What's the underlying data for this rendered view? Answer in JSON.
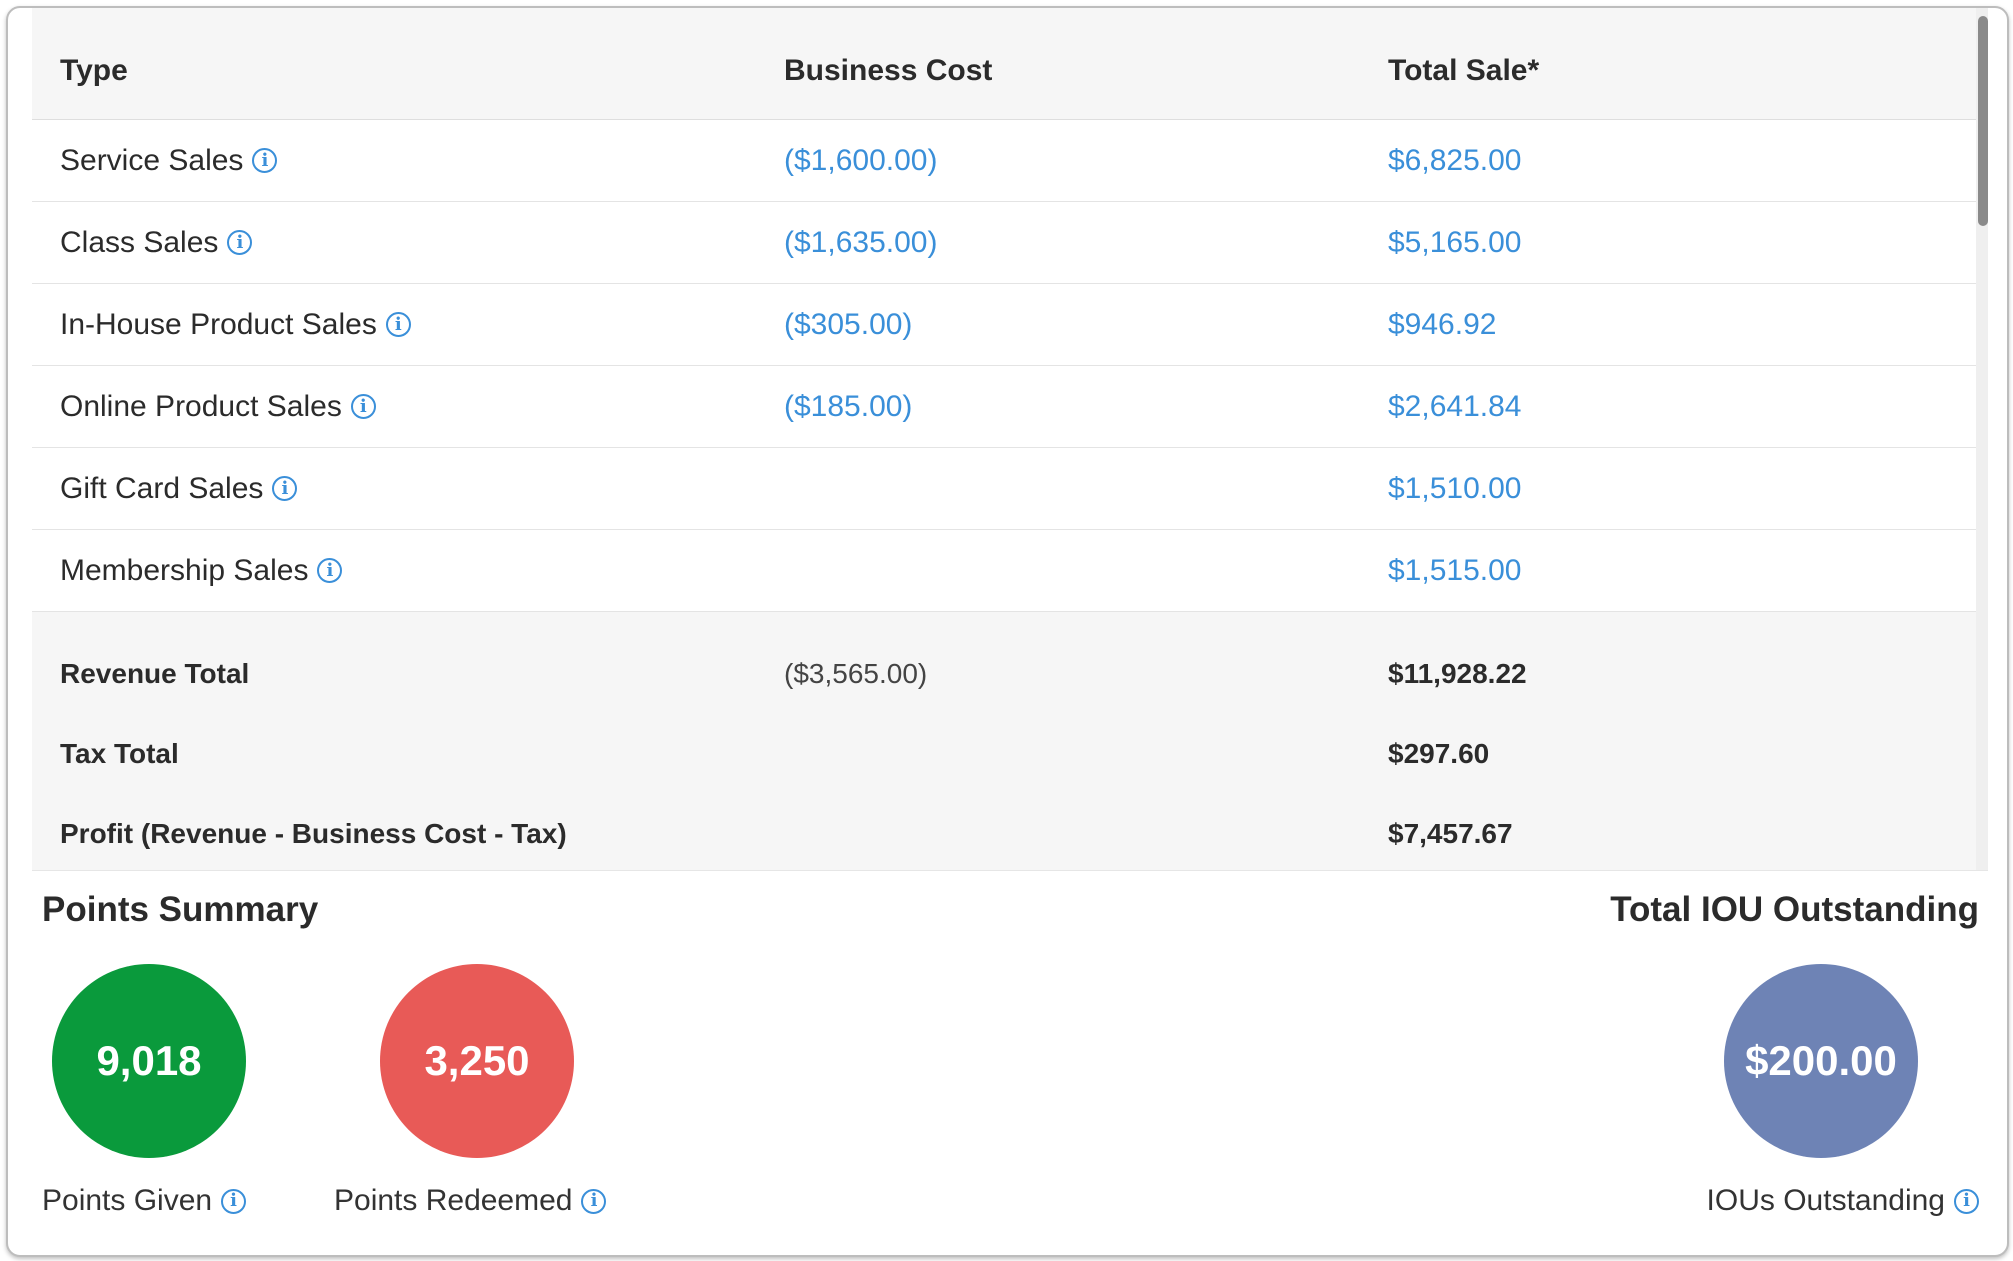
{
  "table": {
    "headers": [
      "Type",
      "Business Cost",
      "Total Sale*"
    ],
    "rows": [
      {
        "type": "Service Sales",
        "cost": "($1,600.00)",
        "total": "$6,825.00"
      },
      {
        "type": "Class Sales",
        "cost": "($1,635.00)",
        "total": "$5,165.00"
      },
      {
        "type": "In-House Product Sales",
        "cost": "($305.00)",
        "total": "$946.92"
      },
      {
        "type": "Online Product Sales",
        "cost": "($185.00)",
        "total": "$2,641.84"
      },
      {
        "type": "Gift Card Sales",
        "cost": "",
        "total": "$1,510.00"
      },
      {
        "type": "Membership Sales",
        "cost": "",
        "total": "$1,515.00"
      }
    ],
    "totals": [
      {
        "label": "Revenue Total",
        "cost": "($3,565.00)",
        "total": "$11,928.22"
      },
      {
        "label": "Tax Total",
        "cost": "",
        "total": "$297.60"
      },
      {
        "label": "Profit (Revenue - Business Cost - Tax)",
        "cost": "",
        "total": "$7,457.67"
      }
    ]
  },
  "points_summary": {
    "title": "Points Summary",
    "given": {
      "value": "9,018",
      "label": "Points Given",
      "color": "#0a9a3c"
    },
    "redeemed": {
      "value": "3,250",
      "label": "Points Redeemed",
      "color": "#e85a57"
    }
  },
  "iou": {
    "title": "Total IOU Outstanding",
    "value": "$200.00",
    "label": "IOUs Outstanding",
    "color": "#6e83b5"
  },
  "colors": {
    "link": "#3a8fd9",
    "info_icon": "#3a8fd9"
  },
  "icons": {
    "info": "info-circle-icon"
  }
}
